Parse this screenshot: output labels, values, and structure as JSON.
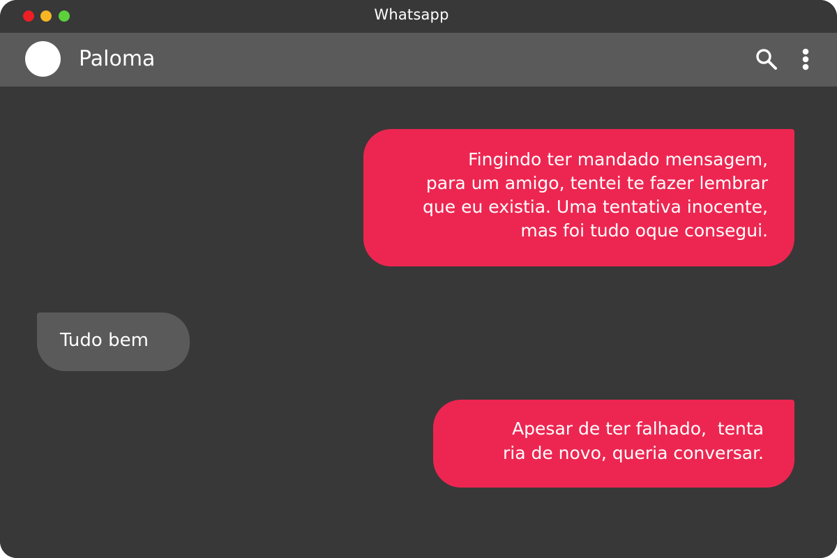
{
  "window": {
    "title": "Whatsapp",
    "controls": [
      "close",
      "minimize",
      "maximize"
    ]
  },
  "header": {
    "contact_name": "Paloma",
    "icons": [
      "search-icon",
      "more-vertical-icon"
    ]
  },
  "messages": [
    {
      "direction": "sent",
      "lines": [
        "Fingindo ter mandado mensagem,",
        "para um amigo, tentei te fazer lembrar",
        "que eu existia. Uma tentativa inocente,",
        "mas foi tudo oque consegui."
      ]
    },
    {
      "direction": "received",
      "lines": [
        "Tudo bem"
      ]
    },
    {
      "direction": "sent",
      "lines": [
        "Apesar de ter falhado,  tenta",
        "ria de novo, queria conversar."
      ]
    }
  ],
  "colors": {
    "background": "#383838",
    "header": "#5a5a5a",
    "sent_bubble": "#ed2651",
    "received_bubble": "#5a5a5a",
    "text": "#ffffff",
    "close": "#ec1f25",
    "minimize": "#f5b524",
    "maximize": "#5cd13c"
  }
}
